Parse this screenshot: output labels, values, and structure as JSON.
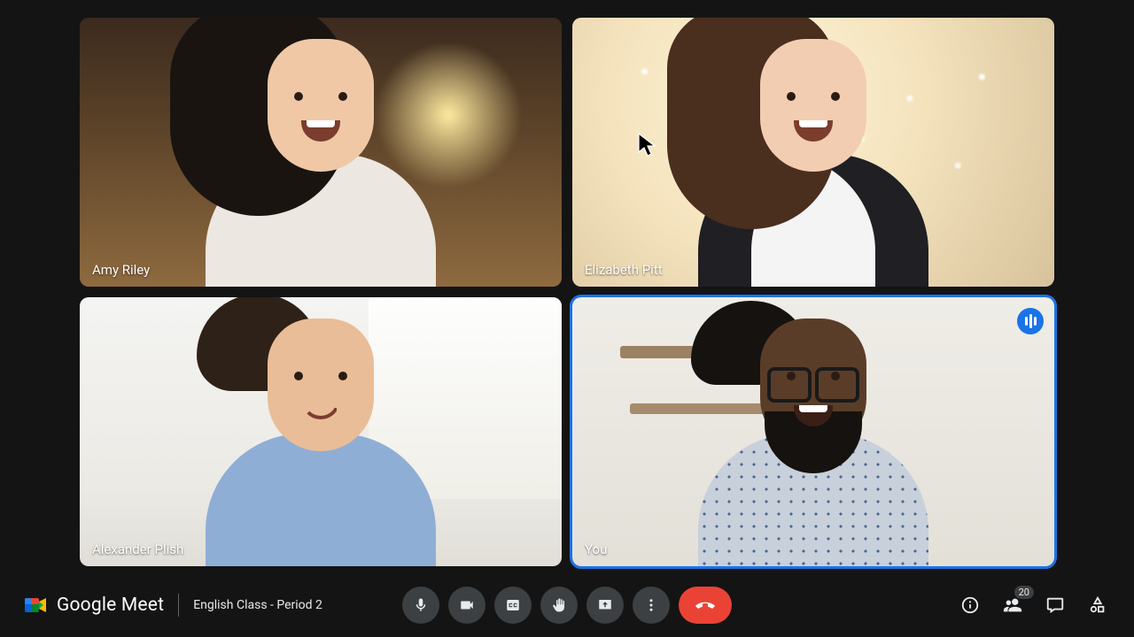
{
  "app": {
    "name": "Google Meet"
  },
  "meeting": {
    "title": "English Class - Period 2"
  },
  "participants": [
    {
      "name": "Amy Riley",
      "is_self": false,
      "speaking": false,
      "active_outline": false
    },
    {
      "name": "Elizabeth Pitt",
      "is_self": false,
      "speaking": false,
      "active_outline": false
    },
    {
      "name": "Alexander Plish",
      "is_self": false,
      "speaking": false,
      "active_outline": false
    },
    {
      "name": "You",
      "is_self": true,
      "speaking": true,
      "active_outline": true
    }
  ],
  "controls": {
    "mic": "Microphone",
    "camera": "Camera",
    "captions": "Turn on captions",
    "raise_hand": "Raise hand",
    "present": "Present now",
    "more": "More options",
    "end": "Leave call"
  },
  "right_panel": {
    "info": "Meeting details",
    "people": "Show everyone",
    "people_count": "20",
    "chat": "Chat with everyone",
    "activities": "Activities"
  },
  "colors": {
    "accent": "#1a73e8",
    "danger": "#ea4335",
    "bg": "#141414",
    "button": "#3c4043"
  }
}
